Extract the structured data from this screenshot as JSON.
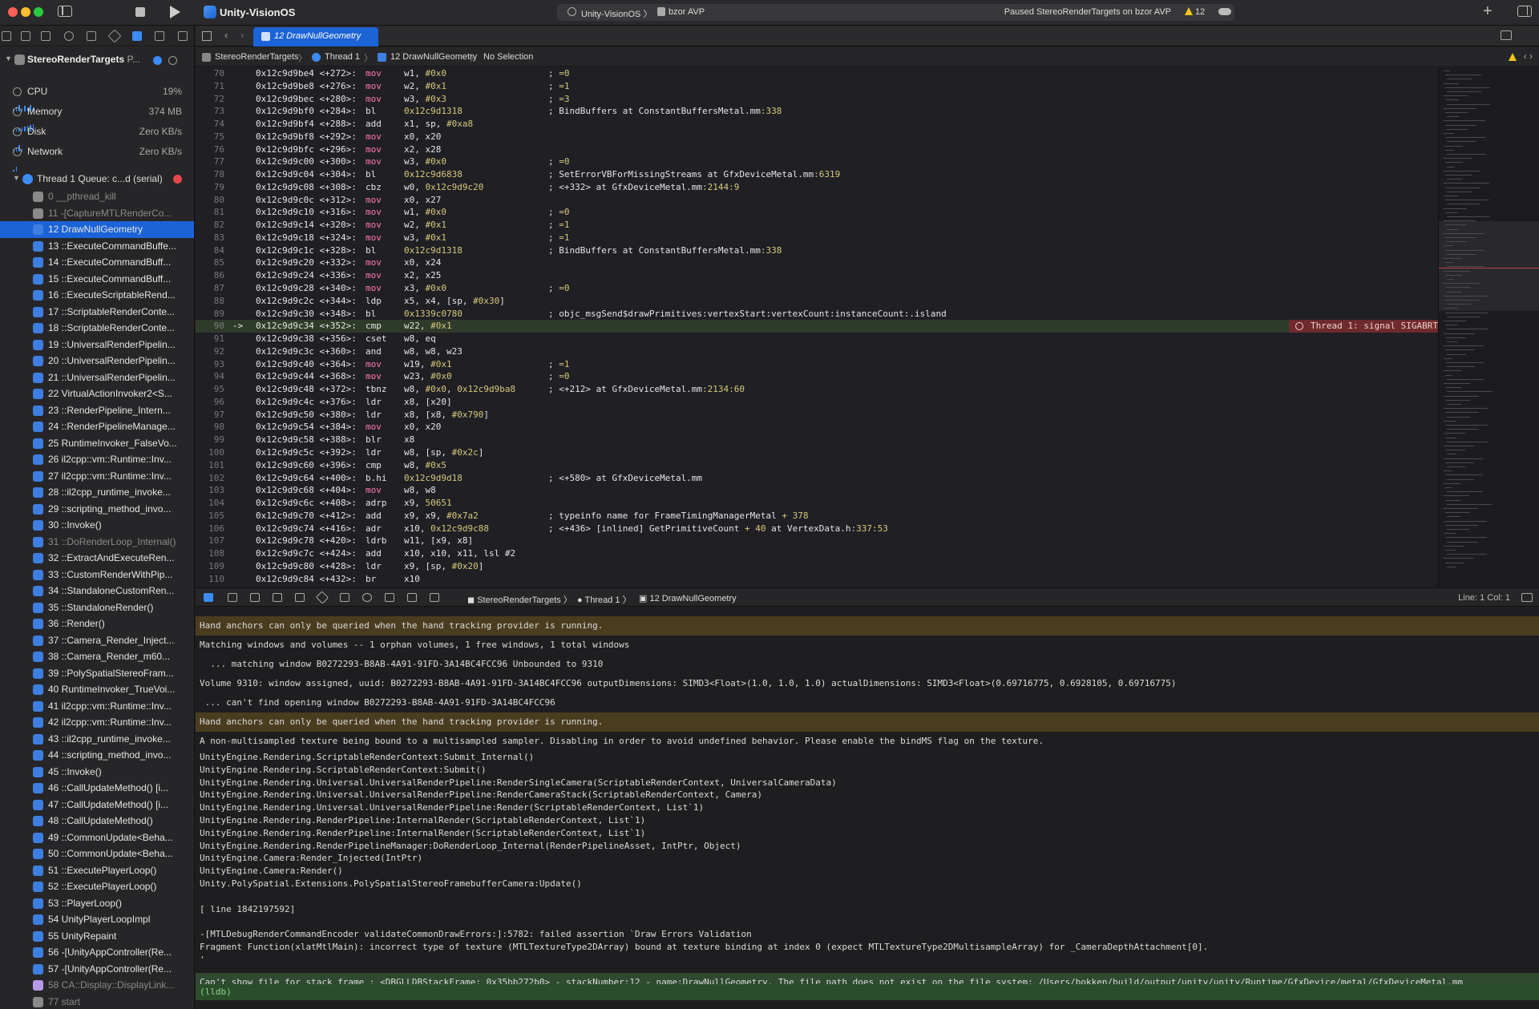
{
  "window": {
    "app_title": "Unity-VisionOS",
    "scheme": "Unity-VisionOS",
    "destination": "bzor AVP",
    "status": "Paused StereoRenderTargets on bzor AVP",
    "warning_count": "12"
  },
  "navigator": {
    "process_name": "StereoRenderTargets",
    "process_suffix": "P...",
    "gauges": [
      {
        "label": "CPU",
        "value": "19%",
        "icon": "cpu-icon"
      },
      {
        "label": "Memory",
        "value": "374 MB",
        "icon": "memory-icon"
      },
      {
        "label": "Disk",
        "value": "Zero KB/s",
        "icon": "disk-icon"
      },
      {
        "label": "Network",
        "value": "Zero KB/s",
        "icon": "network-icon"
      }
    ],
    "thread_label": "Thread 1 Queue: c...d (serial)",
    "frames": [
      {
        "label": "0 __pthread_kill",
        "kind": "sys",
        "dim": true
      },
      {
        "label": "11 -[CaptureMTLRenderCo...",
        "kind": "sys",
        "dim": true
      },
      {
        "label": "12 DrawNullGeometry",
        "kind": "user",
        "selected": true
      },
      {
        "label": "13 ::ExecuteCommandBuffe...",
        "kind": "user"
      },
      {
        "label": "14 ::ExecuteCommandBuff...",
        "kind": "user"
      },
      {
        "label": "15 ::ExecuteCommandBuff...",
        "kind": "user"
      },
      {
        "label": "16 ::ExecuteScriptableRend...",
        "kind": "user"
      },
      {
        "label": "17 ::ScriptableRenderConte...",
        "kind": "user"
      },
      {
        "label": "18 ::ScriptableRenderConte...",
        "kind": "user"
      },
      {
        "label": "19 ::UniversalRenderPipelin...",
        "kind": "user"
      },
      {
        "label": "20 ::UniversalRenderPipelin...",
        "kind": "user"
      },
      {
        "label": "21 ::UniversalRenderPipelin...",
        "kind": "user"
      },
      {
        "label": "22 VirtualActionInvoker2<S...",
        "kind": "user"
      },
      {
        "label": "23 ::RenderPipeline_Intern...",
        "kind": "user"
      },
      {
        "label": "24 ::RenderPipelineManage...",
        "kind": "user"
      },
      {
        "label": "25 RuntimeInvoker_FalseVo...",
        "kind": "user"
      },
      {
        "label": "26 il2cpp::vm::Runtime::Inv...",
        "kind": "user"
      },
      {
        "label": "27 il2cpp::vm::Runtime::Inv...",
        "kind": "user"
      },
      {
        "label": "28 ::il2cpp_runtime_invoke...",
        "kind": "user"
      },
      {
        "label": "29 ::scripting_method_invo...",
        "kind": "user"
      },
      {
        "label": "30 ::Invoke()",
        "kind": "user"
      },
      {
        "label": "31 ::DoRenderLoop_Internal()",
        "kind": "user",
        "dim": true
      },
      {
        "label": "32 ::ExtractAndExecuteRen...",
        "kind": "user"
      },
      {
        "label": "33 ::CustomRenderWithPip...",
        "kind": "user"
      },
      {
        "label": "34 ::StandaloneCustomRen...",
        "kind": "user"
      },
      {
        "label": "35 ::StandaloneRender()",
        "kind": "user"
      },
      {
        "label": "36 ::Render()",
        "kind": "user"
      },
      {
        "label": "37 ::Camera_Render_Inject...",
        "kind": "user"
      },
      {
        "label": "38 ::Camera_Render_m60...",
        "kind": "user"
      },
      {
        "label": "39 ::PolySpatialStereoFram...",
        "kind": "user"
      },
      {
        "label": "40 RuntimeInvoker_TrueVoi...",
        "kind": "user"
      },
      {
        "label": "41 il2cpp::vm::Runtime::Inv...",
        "kind": "user"
      },
      {
        "label": "42 il2cpp::vm::Runtime::Inv...",
        "kind": "user"
      },
      {
        "label": "43 ::il2cpp_runtime_invoke...",
        "kind": "user"
      },
      {
        "label": "44 ::scripting_method_invo...",
        "kind": "user"
      },
      {
        "label": "45 ::Invoke()",
        "kind": "user"
      },
      {
        "label": "46 ::CallUpdateMethod() [i...",
        "kind": "user"
      },
      {
        "label": "47 ::CallUpdateMethod() [i...",
        "kind": "user"
      },
      {
        "label": "48 ::CallUpdateMethod()",
        "kind": "user"
      },
      {
        "label": "49 ::CommonUpdate<Beha...",
        "kind": "user"
      },
      {
        "label": "50 ::CommonUpdate<Beha...",
        "kind": "user"
      },
      {
        "label": "51 ::ExecutePlayerLoop()",
        "kind": "user"
      },
      {
        "label": "52 ::ExecutePlayerLoop()",
        "kind": "user"
      },
      {
        "label": "53 ::PlayerLoop()",
        "kind": "user"
      },
      {
        "label": "54 UnityPlayerLoopImpl",
        "kind": "user"
      },
      {
        "label": "55 UnityRepaint",
        "kind": "user"
      },
      {
        "label": "56 -[UnityAppController(Re...",
        "kind": "user"
      },
      {
        "label": "57 -[UnityAppController(Re...",
        "kind": "user"
      },
      {
        "label": "58 CA::Display::DisplayLink...",
        "kind": "cap",
        "dim": true
      },
      {
        "label": "77 start",
        "kind": "sys",
        "dim": true
      }
    ]
  },
  "editor": {
    "active_tab": "12 DrawNullGeometry",
    "jumpbar": [
      "StereoRenderTargets",
      "Thread 1",
      "12 DrawNullGeometry",
      "No Selection"
    ],
    "signal": "Thread 1: signal SIGABRT",
    "lines": [
      {
        "n": "70",
        "addr": "0x12c9d9be4 <+272>:",
        "op": "mov",
        "args": "w1, #0x0",
        "cmt": "; =0"
      },
      {
        "n": "71",
        "addr": "0x12c9d9be8 <+276>:",
        "op": "mov",
        "args": "w2, #0x1",
        "cmt": "; =1"
      },
      {
        "n": "72",
        "addr": "0x12c9d9bec <+280>:",
        "op": "mov",
        "args": "w3, #0x3",
        "cmt": "; =3"
      },
      {
        "n": "73",
        "addr": "0x12c9d9bf0 <+284>:",
        "op": "bl",
        "args": "0x12c9d1318",
        "cmt": "; BindBuffers at ConstantBuffersMetal.mm:338"
      },
      {
        "n": "74",
        "addr": "0x12c9d9bf4 <+288>:",
        "op": "add",
        "args": "x1, sp, #0xa8",
        "cmt": ""
      },
      {
        "n": "75",
        "addr": "0x12c9d9bf8 <+292>:",
        "op": "mov",
        "args": "x0, x20",
        "cmt": ""
      },
      {
        "n": "76",
        "addr": "0x12c9d9bfc <+296>:",
        "op": "mov",
        "args": "x2, x28",
        "cmt": ""
      },
      {
        "n": "77",
        "addr": "0x12c9d9c00 <+300>:",
        "op": "mov",
        "args": "w3, #0x0",
        "cmt": "; =0"
      },
      {
        "n": "78",
        "addr": "0x12c9d9c04 <+304>:",
        "op": "bl",
        "args": "0x12c9d6838",
        "cmt": "; SetErrorVBForMissingStreams at GfxDeviceMetal.mm:6319"
      },
      {
        "n": "79",
        "addr": "0x12c9d9c08 <+308>:",
        "op": "cbz",
        "args": "w0, 0x12c9d9c20",
        "cmt": "; <+332> at GfxDeviceMetal.mm:2144:9"
      },
      {
        "n": "80",
        "addr": "0x12c9d9c0c <+312>:",
        "op": "mov",
        "args": "x0, x27",
        "cmt": ""
      },
      {
        "n": "81",
        "addr": "0x12c9d9c10 <+316>:",
        "op": "mov",
        "args": "w1, #0x0",
        "cmt": "; =0"
      },
      {
        "n": "82",
        "addr": "0x12c9d9c14 <+320>:",
        "op": "mov",
        "args": "w2, #0x1",
        "cmt": "; =1"
      },
      {
        "n": "83",
        "addr": "0x12c9d9c18 <+324>:",
        "op": "mov",
        "args": "w3, #0x1",
        "cmt": "; =1"
      },
      {
        "n": "84",
        "addr": "0x12c9d9c1c <+328>:",
        "op": "bl",
        "args": "0x12c9d1318",
        "cmt": "; BindBuffers at ConstantBuffersMetal.mm:338"
      },
      {
        "n": "85",
        "addr": "0x12c9d9c20 <+332>:",
        "op": "mov",
        "args": "x0, x24",
        "cmt": ""
      },
      {
        "n": "86",
        "addr": "0x12c9d9c24 <+336>:",
        "op": "mov",
        "args": "x2, x25",
        "cmt": ""
      },
      {
        "n": "87",
        "addr": "0x12c9d9c28 <+340>:",
        "op": "mov",
        "args": "x3, #0x0",
        "cmt": "; =0"
      },
      {
        "n": "88",
        "addr": "0x12c9d9c2c <+344>:",
        "op": "ldp",
        "args": "x5, x4, [sp, #0x30]",
        "cmt": ""
      },
      {
        "n": "89",
        "addr": "0x12c9d9c30 <+348>:",
        "op": "bl",
        "args": "0x1339c0780",
        "cmt": "; objc_msgSend$drawPrimitives:vertexStart:vertexCount:instanceCount:.island"
      },
      {
        "n": "90",
        "addr": "0x12c9d9c34 <+352>:",
        "op": "cmp",
        "args": "w22, #0x1",
        "cmt": "",
        "current": true
      },
      {
        "n": "91",
        "addr": "0x12c9d9c38 <+356>:",
        "op": "cset",
        "args": "w8, eq",
        "cmt": ""
      },
      {
        "n": "92",
        "addr": "0x12c9d9c3c <+360>:",
        "op": "and",
        "args": "w8, w8, w23",
        "cmt": ""
      },
      {
        "n": "93",
        "addr": "0x12c9d9c40 <+364>:",
        "op": "mov",
        "args": "w19, #0x1",
        "cmt": "; =1"
      },
      {
        "n": "94",
        "addr": "0x12c9d9c44 <+368>:",
        "op": "mov",
        "args": "w23, #0x0",
        "cmt": "; =0"
      },
      {
        "n": "95",
        "addr": "0x12c9d9c48 <+372>:",
        "op": "tbnz",
        "args": "w8, #0x0, 0x12c9d9ba8",
        "cmt": "; <+212> at GfxDeviceMetal.mm:2134:60"
      },
      {
        "n": "96",
        "addr": "0x12c9d9c4c <+376>:",
        "op": "ldr",
        "args": "x8, [x20]",
        "cmt": ""
      },
      {
        "n": "97",
        "addr": "0x12c9d9c50 <+380>:",
        "op": "ldr",
        "args": "x8, [x8, #0x790]",
        "cmt": ""
      },
      {
        "n": "98",
        "addr": "0x12c9d9c54 <+384>:",
        "op": "mov",
        "args": "x0, x20",
        "cmt": ""
      },
      {
        "n": "99",
        "addr": "0x12c9d9c58 <+388>:",
        "op": "blr",
        "args": "x8",
        "cmt": ""
      },
      {
        "n": "100",
        "addr": "0x12c9d9c5c <+392>:",
        "op": "ldr",
        "args": "w8, [sp, #0x2c]",
        "cmt": ""
      },
      {
        "n": "101",
        "addr": "0x12c9d9c60 <+396>:",
        "op": "cmp",
        "args": "w8, #0x5",
        "cmt": ""
      },
      {
        "n": "102",
        "addr": "0x12c9d9c64 <+400>:",
        "op": "b.hi",
        "args": "0x12c9d9d18",
        "cmt": "; <+580> at GfxDeviceMetal.mm"
      },
      {
        "n": "103",
        "addr": "0x12c9d9c68 <+404>:",
        "op": "mov",
        "args": "w8, w8",
        "cmt": ""
      },
      {
        "n": "104",
        "addr": "0x12c9d9c6c <+408>:",
        "op": "adrp",
        "args": "x9, 50651",
        "cmt": ""
      },
      {
        "n": "105",
        "addr": "0x12c9d9c70 <+412>:",
        "op": "add",
        "args": "x9, x9, #0x7a2",
        "cmt": "; typeinfo name for FrameTimingManagerMetal + 378"
      },
      {
        "n": "106",
        "addr": "0x12c9d9c74 <+416>:",
        "op": "adr",
        "args": "x10, 0x12c9d9c88",
        "cmt": "; <+436> [inlined] GetPrimitiveCount + 40 at VertexData.h:337:53"
      },
      {
        "n": "107",
        "addr": "0x12c9d9c78 <+420>:",
        "op": "ldrb",
        "args": "w11, [x9, x8]",
        "cmt": ""
      },
      {
        "n": "108",
        "addr": "0x12c9d9c7c <+424>:",
        "op": "add",
        "args": "x10, x10, x11, lsl #2",
        "cmt": ""
      },
      {
        "n": "109",
        "addr": "0x12c9d9c80 <+428>:",
        "op": "ldr",
        "args": "x9, [sp, #0x20]",
        "cmt": ""
      },
      {
        "n": "110",
        "addr": "0x12c9d9c84 <+432>:",
        "op": "br",
        "args": "x10",
        "cmt": ""
      }
    ]
  },
  "debugbar": {
    "process": "StereoRenderTargets",
    "thread": "Thread 1",
    "frame": "12 DrawNullGeometry",
    "line_col": "Line: 1  Col: 1"
  },
  "console": {
    "lines": [
      {
        "text": "Hand anchors can only be queried when the hand tracking provider is running.",
        "kind": "warn"
      },
      {
        "text": "Matching windows and volumes -- 1 orphan volumes, 1 free windows, 1 total windows",
        "kind": "plain"
      },
      {
        "text": "  ... matching window B0272293-B8AB-4A91-91FD-3A14BC4FCC96 Unbounded to 9310",
        "kind": "plain"
      },
      {
        "text": "Volume 9310: window assigned, uuid: B0272293-B8AB-4A91-91FD-3A14BC4FCC96 outputDimensions: SIMD3<Float>(1.0, 1.0, 1.0) actualDimensions: SIMD3<Float>(0.69716775, 0.6928105, 0.69716775)",
        "kind": "plain"
      },
      {
        "text": " ... can't find opening window B0272293-B8AB-4A91-91FD-3A14BC4FCC96",
        "kind": "plain"
      },
      {
        "text": "Hand anchors can only be queried when the hand tracking provider is running.",
        "kind": "warn"
      },
      {
        "text": "A non-multisampled texture being bound to a multisampled sampler. Disabling in order to avoid undefined behavior. Please enable the bindMS flag on the texture.",
        "kind": "plain"
      },
      {
        "text": "UnityEngine.Rendering.ScriptableRenderContext:Submit_Internal()",
        "kind": "tight"
      },
      {
        "text": "UnityEngine.Rendering.ScriptableRenderContext:Submit()",
        "kind": "tight"
      },
      {
        "text": "UnityEngine.Rendering.Universal.UniversalRenderPipeline:RenderSingleCamera(ScriptableRenderContext, UniversalCameraData)",
        "kind": "tight"
      },
      {
        "text": "UnityEngine.Rendering.Universal.UniversalRenderPipeline:RenderCameraStack(ScriptableRenderContext, Camera)",
        "kind": "tight"
      },
      {
        "text": "UnityEngine.Rendering.Universal.UniversalRenderPipeline:Render(ScriptableRenderContext, List`1)",
        "kind": "tight"
      },
      {
        "text": "UnityEngine.Rendering.RenderPipeline:InternalRender(ScriptableRenderContext, List`1)",
        "kind": "tight"
      },
      {
        "text": "UnityEngine.Rendering.RenderPipeline:InternalRender(ScriptableRenderContext, List`1)",
        "kind": "tight"
      },
      {
        "text": "UnityEngine.Rendering.RenderPipelineManager:DoRenderLoop_Internal(RenderPipelineAsset, IntPtr, Object)",
        "kind": "tight"
      },
      {
        "text": "UnityEngine.Camera:Render_Injected(IntPtr)",
        "kind": "tight"
      },
      {
        "text": "UnityEngine.Camera:Render()",
        "kind": "tight"
      },
      {
        "text": "Unity.PolySpatial.Extensions.PolySpatialStereoFramebufferCamera:Update()",
        "kind": "tight"
      },
      {
        "text": "",
        "kind": "tight"
      },
      {
        "text": "[ line 1842197592]",
        "kind": "tight"
      },
      {
        "text": "",
        "kind": "tight"
      },
      {
        "text": "-[MTLDebugRenderCommandEncoder validateCommonDrawErrors:]:5782: failed assertion `Draw Errors Validation",
        "kind": "tight"
      },
      {
        "text": "Fragment Function(xlatMtlMain): incorrect type of texture (MTLTextureType2DArray) bound at texture binding at index 0 (expect MTLTextureType2DMultisampleArray) for _CameraDepthAttachment[0].",
        "kind": "tight"
      },
      {
        "text": "'",
        "kind": "tight"
      },
      {
        "text": "Can't show file for stack frame : <DBGLLDBStackFrame: 0x35bb272b0> - stackNumber:12 - name:DrawNullGeometry. The file path does not exist on the file system: /Users/bokken/build/output/unity/unity/Runtime/GfxDevice/metal/GfxDeviceMetal.mm",
        "kind": "err"
      }
    ],
    "prompt": "(lldb)"
  }
}
